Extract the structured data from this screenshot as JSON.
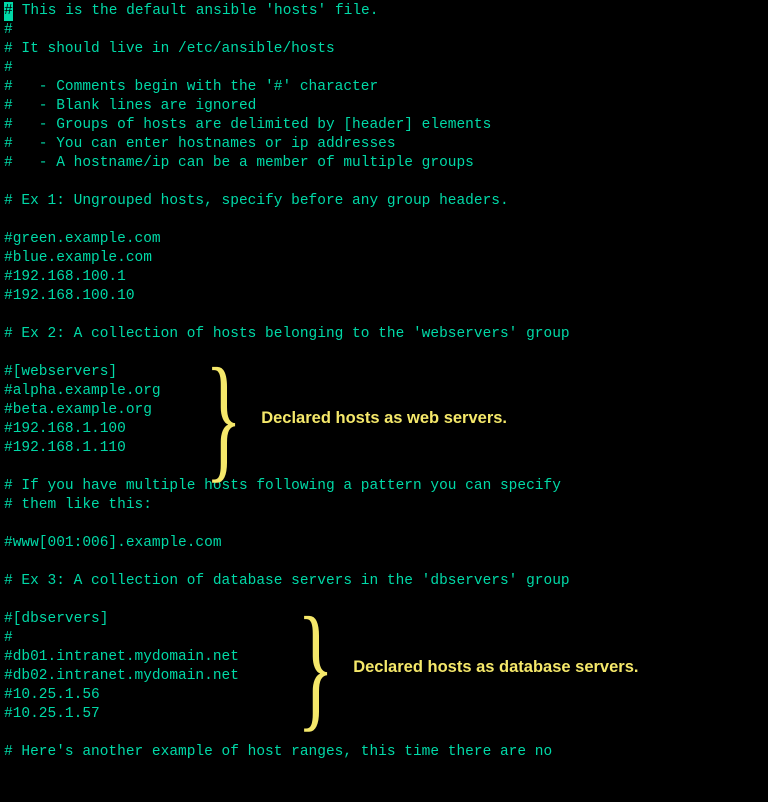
{
  "lines": [
    {
      "cursor": true,
      "rest": " This is the default ansible 'hosts' file."
    },
    {
      "text": "#"
    },
    {
      "text": "# It should live in /etc/ansible/hosts"
    },
    {
      "text": "#"
    },
    {
      "text": "#   - Comments begin with the '#' character"
    },
    {
      "text": "#   - Blank lines are ignored"
    },
    {
      "text": "#   - Groups of hosts are delimited by [header] elements"
    },
    {
      "text": "#   - You can enter hostnames or ip addresses"
    },
    {
      "text": "#   - A hostname/ip can be a member of multiple groups"
    },
    {
      "text": ""
    },
    {
      "text": "# Ex 1: Ungrouped hosts, specify before any group headers."
    },
    {
      "text": ""
    },
    {
      "text": "#green.example.com"
    },
    {
      "text": "#blue.example.com"
    },
    {
      "text": "#192.168.100.1"
    },
    {
      "text": "#192.168.100.10"
    },
    {
      "text": ""
    },
    {
      "text": "# Ex 2: A collection of hosts belonging to the 'webservers' group"
    },
    {
      "text": ""
    },
    {
      "text": "#[webservers]"
    },
    {
      "text": "#alpha.example.org"
    },
    {
      "text": "#beta.example.org"
    },
    {
      "text": "#192.168.1.100"
    },
    {
      "text": "#192.168.1.110"
    },
    {
      "text": ""
    },
    {
      "text": "# If you have multiple hosts following a pattern you can specify"
    },
    {
      "text": "# them like this:"
    },
    {
      "text": ""
    },
    {
      "text": "#www[001:006].example.com"
    },
    {
      "text": ""
    },
    {
      "text": "# Ex 3: A collection of database servers in the 'dbservers' group"
    },
    {
      "text": ""
    },
    {
      "text": "#[dbservers]"
    },
    {
      "text": "#"
    },
    {
      "text": "#db01.intranet.mydomain.net"
    },
    {
      "text": "#db02.intranet.mydomain.net"
    },
    {
      "text": "#10.25.1.56"
    },
    {
      "text": "#10.25.1.57"
    },
    {
      "text": ""
    },
    {
      "text": "# Here's another example of host ranges, this time there are no"
    }
  ],
  "annot1": {
    "brace": "}",
    "label": "Declared hosts as web servers."
  },
  "annot2": {
    "brace": "}",
    "label": "Declared hosts as database servers."
  }
}
